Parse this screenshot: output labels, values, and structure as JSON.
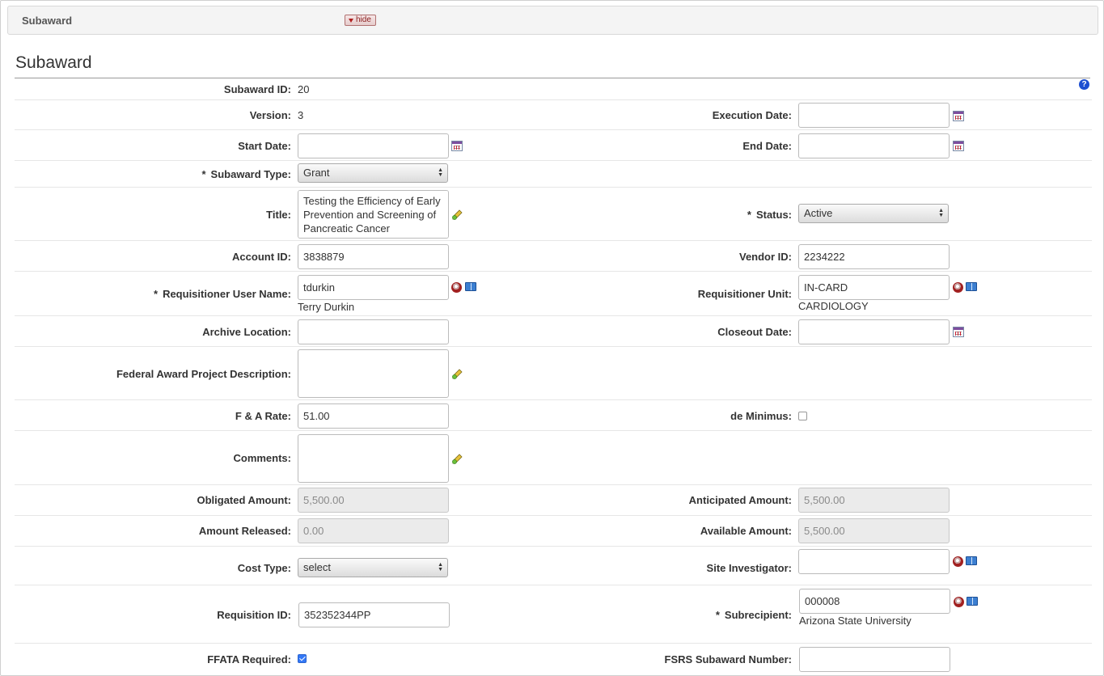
{
  "panel": {
    "title": "Subaward",
    "hide_label": "hide"
  },
  "section": {
    "title": "Subaward",
    "help": "?"
  },
  "fields": {
    "subaward_id": {
      "label": "Subaward ID:",
      "value": "20"
    },
    "version": {
      "label": "Version:",
      "value": "3"
    },
    "execution_date": {
      "label": "Execution Date:",
      "value": ""
    },
    "start_date": {
      "label": "Start Date:",
      "value": ""
    },
    "end_date": {
      "label": "End Date:",
      "value": ""
    },
    "subaward_type": {
      "label": "Subaward Type:",
      "value": "Grant",
      "required": "*"
    },
    "title": {
      "label": "Title:",
      "value": "Testing the Efficiency of Early Prevention and Screening of Pancreatic Cancer"
    },
    "status": {
      "label": "Status:",
      "value": "Active",
      "required": "*"
    },
    "account_id": {
      "label": "Account ID:",
      "value": "3838879"
    },
    "vendor_id": {
      "label": "Vendor ID:",
      "value": "2234222"
    },
    "requisitioner_user_name": {
      "label": "Requisitioner User Name:",
      "value": "tdurkin",
      "display": "Terry Durkin",
      "required": "*"
    },
    "requisitioner_unit": {
      "label": "Requisitioner Unit:",
      "value": "IN-CARD",
      "display": "CARDIOLOGY"
    },
    "archive_location": {
      "label": "Archive Location:",
      "value": ""
    },
    "closeout_date": {
      "label": "Closeout Date:",
      "value": ""
    },
    "federal_award_project_description": {
      "label": "Federal Award Project Description:",
      "value": ""
    },
    "fa_rate": {
      "label": "F & A Rate:",
      "value": "51.00"
    },
    "de_minimus": {
      "label": "de Minimus:",
      "checked": false
    },
    "comments": {
      "label": "Comments:",
      "value": ""
    },
    "obligated_amount": {
      "label": "Obligated Amount:",
      "value": "5,500.00"
    },
    "anticipated_amount": {
      "label": "Anticipated Amount:",
      "value": "5,500.00"
    },
    "amount_released": {
      "label": "Amount Released:",
      "value": "0.00"
    },
    "available_amount": {
      "label": "Available Amount:",
      "value": "5,500.00"
    },
    "cost_type": {
      "label": "Cost Type:",
      "value": "select"
    },
    "site_investigator": {
      "label": "Site Investigator:",
      "value": ""
    },
    "requisition_id": {
      "label": "Requisition ID:",
      "value": "352352344PP"
    },
    "subrecipient": {
      "label": "Subrecipient:",
      "value": "000008",
      "display": "Arizona State University",
      "required": "*"
    },
    "ffata_required": {
      "label": "FFATA Required:",
      "checked": true
    },
    "fsrs_subaward_number": {
      "label": "FSRS Subaward Number:",
      "value": ""
    }
  }
}
